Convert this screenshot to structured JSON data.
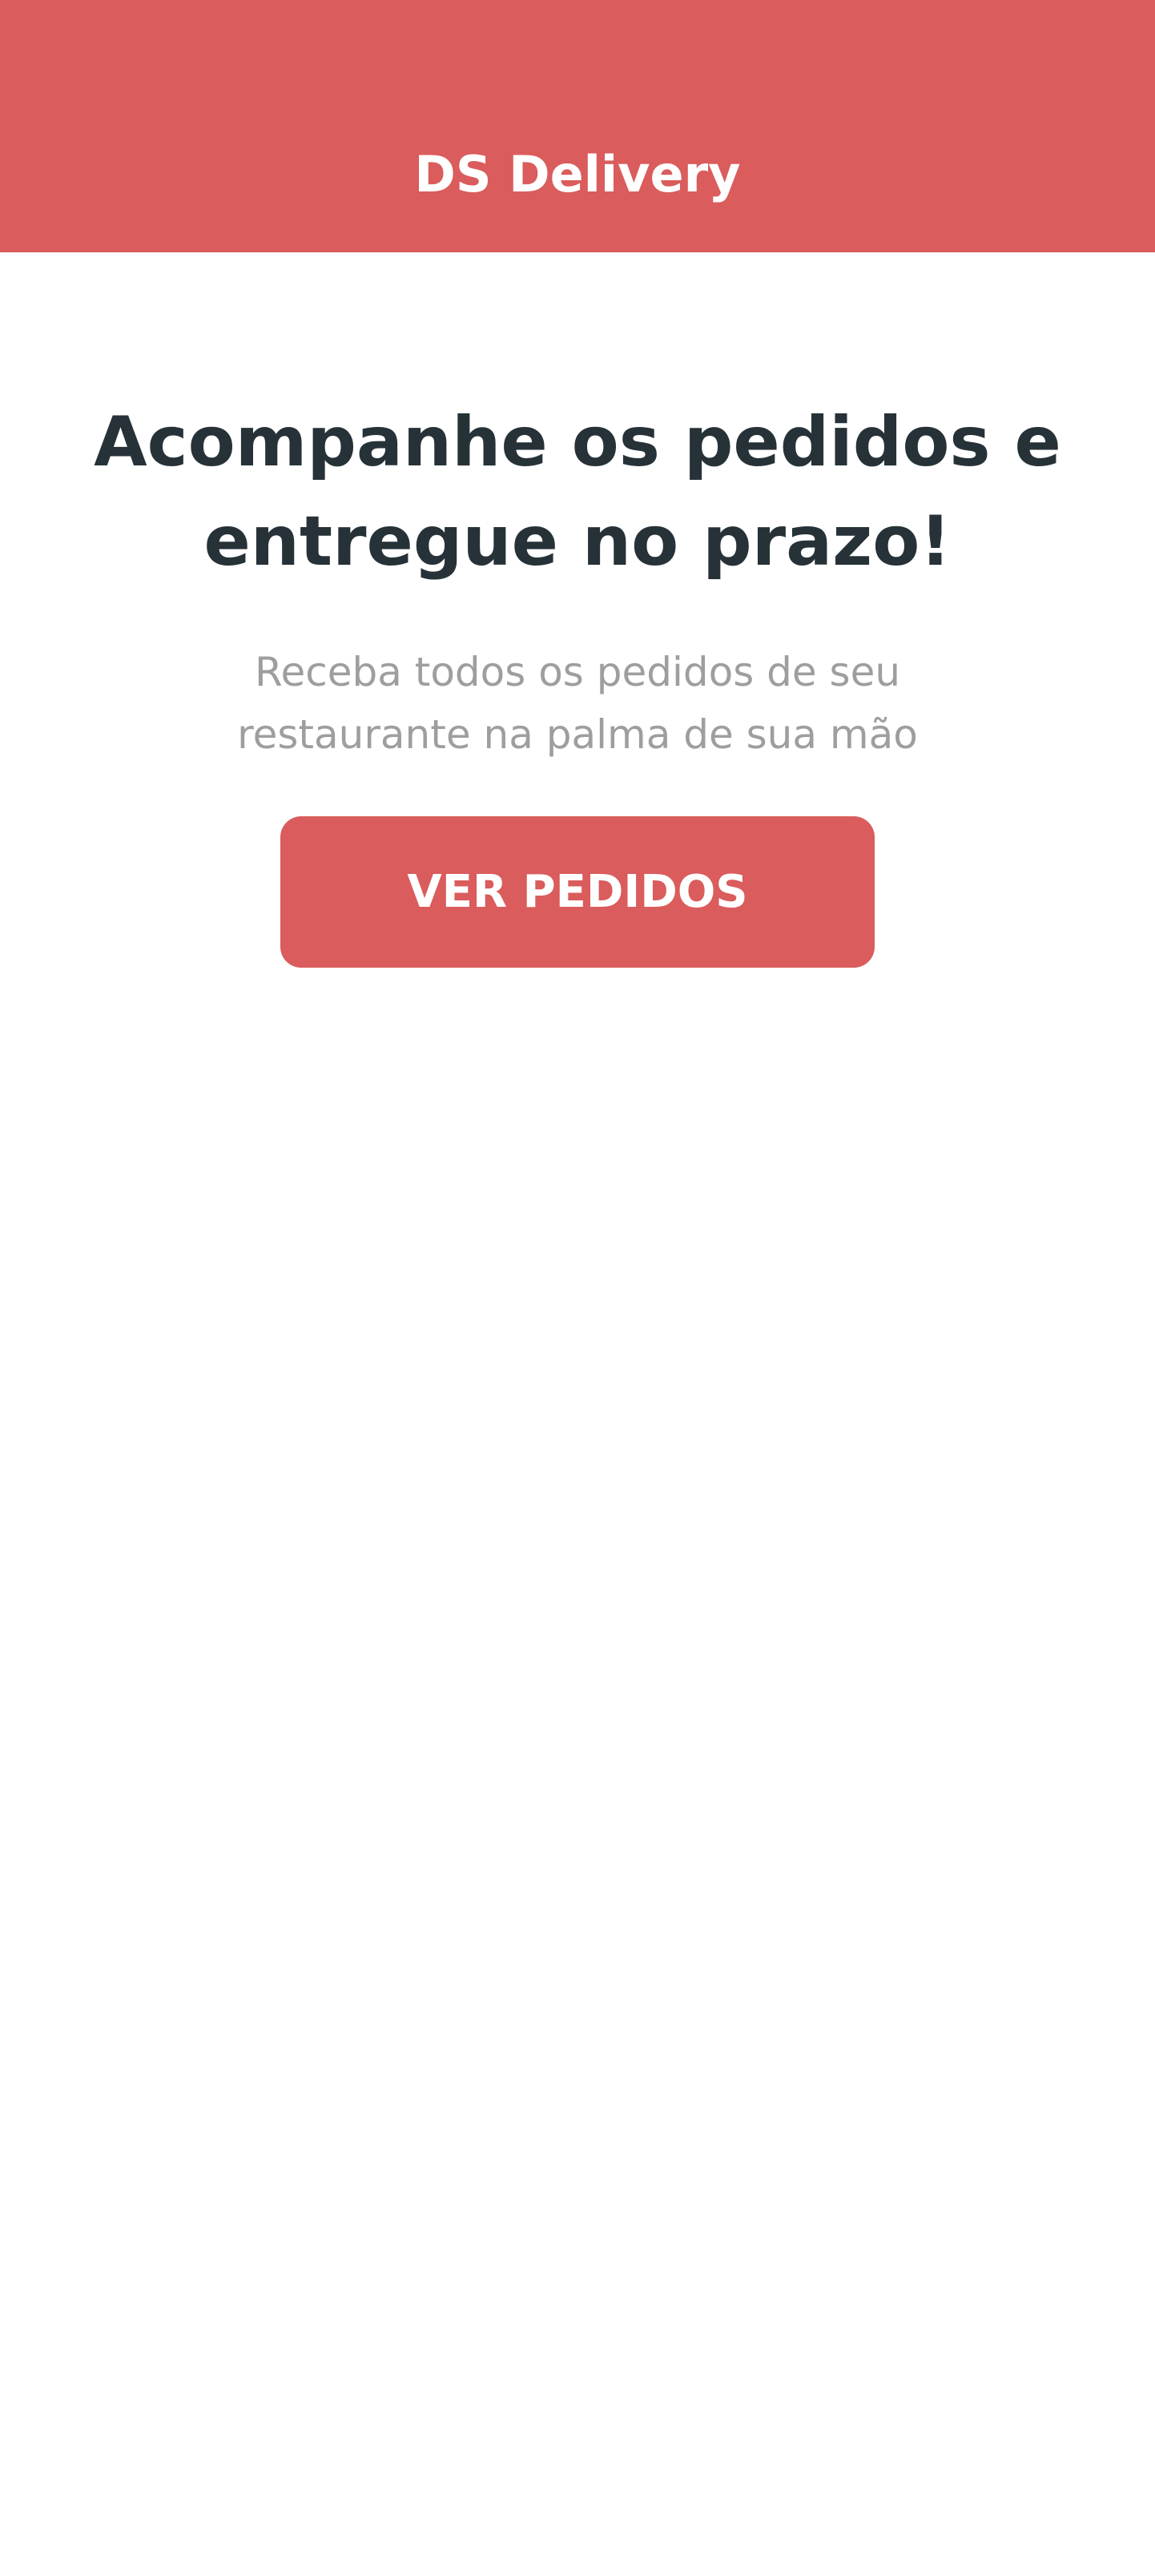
{
  "header": {
    "title": "DS Delivery",
    "background_color": "#DA5C5C",
    "text_color": "#FFFFFF"
  },
  "hero": {
    "title": "Acompanhe os pedidos e entregue no prazo!",
    "subtitle": "Receba todos os pedidos de seu restaurante na palma de sua mão"
  },
  "actions": {
    "primary_label": "VER PEDIDOS",
    "primary_color": "#DA5C5C"
  }
}
